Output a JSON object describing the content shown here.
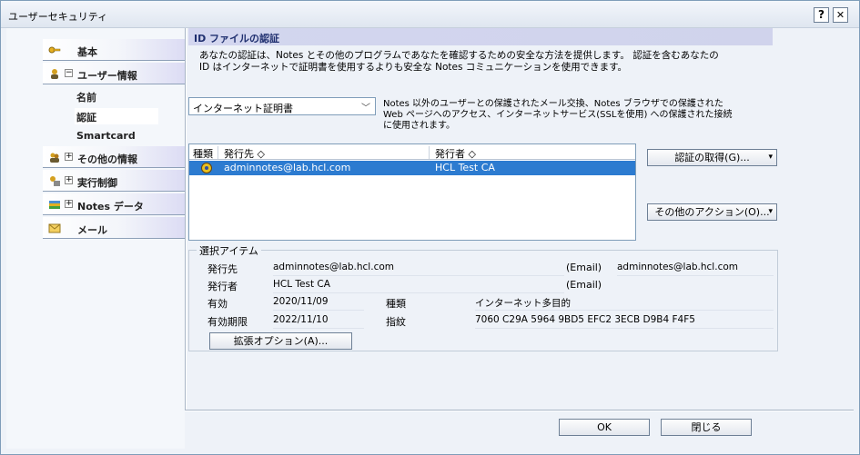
{
  "window": {
    "title": "ユーザーセキュリティ",
    "help_label": "?",
    "close_label": "✕"
  },
  "sidebar": {
    "items": [
      {
        "label": "基本",
        "icon": "key-icon",
        "expander": ""
      },
      {
        "label": "ユーザー情報",
        "icon": "user-icon",
        "expander": "⊟"
      },
      {
        "label": "その他の情報",
        "icon": "people-icon",
        "expander": "⊞"
      },
      {
        "label": "実行制御",
        "icon": "control-icon",
        "expander": "⊞"
      },
      {
        "label": "Notes データ",
        "icon": "database-icon",
        "expander": "⊞"
      },
      {
        "label": "メール",
        "icon": "mail-icon",
        "expander": ""
      }
    ],
    "subitems": [
      {
        "label": "名前"
      },
      {
        "label": "認証"
      },
      {
        "label": "Smartcard"
      }
    ]
  },
  "main": {
    "section_title": "ID ファイルの認証",
    "description_line1": "あなたの認証は、Notes とその他のプログラムであなたを確認するための安全な方法を提供します。 認証を含むあなたの",
    "description_line2": "ID はインターネットで証明書を使用するよりも安全な Notes コミュニケーションを使用できます。",
    "cert_type": {
      "selected": "インターネット証明書"
    },
    "cert_type_desc_line1": "Notes 以外のユーザーとの保護されたメール交換、Notes ブラウザでの保護された",
    "cert_type_desc_line2": "Web ページへのアクセス、インターネットサービス(SSLを使用) への保護された接続",
    "cert_type_desc_line3": "に使用されます。",
    "table": {
      "headers": {
        "type": "種類",
        "issued_to": "発行先 ◇",
        "issuer": "発行者 ◇"
      },
      "rows": [
        {
          "issued_to": "adminnotes@lab.hcl.com",
          "issuer": "HCL Test CA"
        }
      ]
    },
    "buttons": {
      "get_cert": "認証の取得(G)...",
      "other_actions": "その他のアクション(O)...",
      "dropdown": "▾"
    },
    "selected_item": {
      "group_title": "選択アイテム",
      "issued_to_label": "発行先",
      "issued_to": "adminnotes@lab.hcl.com",
      "email_label1": "(Email)",
      "email_value1": "adminnotes@lab.hcl.com",
      "issuer_label": "発行者",
      "issuer": "HCL Test CA",
      "email_label2": "(Email)",
      "valid_label": "有効",
      "valid_from": "2020/11/09",
      "kind_label": "種類",
      "kind_value": "インターネット多目的",
      "expires_label": "有効期限",
      "expires": "2022/11/10",
      "fingerprint_label": "指紋",
      "fingerprint": "7060 C29A 5964 9BD5 EFC2 3ECB D9B4 F4F5",
      "extended_options": "拡張オプション(A)..."
    }
  },
  "footer": {
    "ok_label": "OK",
    "close_label": "閉じる"
  },
  "colors": {
    "selection": "#2c7bd0",
    "section_title_bg": "#d3d6ef",
    "section_title_fg": "#1f2f6f"
  }
}
